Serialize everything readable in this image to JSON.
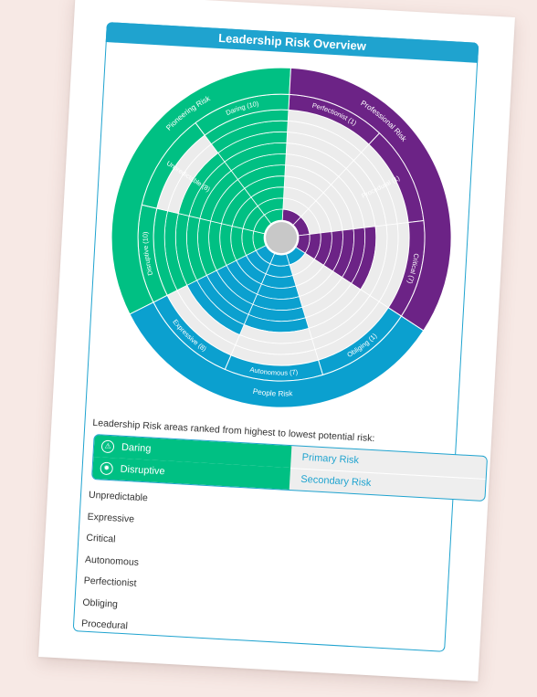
{
  "document": {
    "title": "Leadership Risk Overview"
  },
  "chart_data": {
    "type": "radial-bar",
    "max_value": 10,
    "groups": [
      {
        "name": "Pioneering Risk",
        "color": "#00c083",
        "scales": [
          "Daring",
          "Unpredictable",
          "Disruptive"
        ]
      },
      {
        "name": "Professional Risk",
        "color": "#6c2386",
        "scales": [
          "Perfectionist",
          "Procedural",
          "Critical"
        ]
      },
      {
        "name": "People Risk",
        "color": "#0ba0cf",
        "scales": [
          "Obliging",
          "Autonomous",
          "Expressive"
        ]
      }
    ],
    "segments": [
      {
        "scale": "Perfectionist",
        "label": "Perfectionist (1)",
        "value": 1,
        "group": "Professional Risk"
      },
      {
        "scale": "Procedural",
        "label": "Procedural (1)",
        "value": 1,
        "group": "Professional Risk"
      },
      {
        "scale": "Critical",
        "label": "Critical (7)",
        "value": 7,
        "group": "Professional Risk"
      },
      {
        "scale": "Obliging",
        "label": "Obliging (1)",
        "value": 1,
        "group": "People Risk"
      },
      {
        "scale": "Autonomous",
        "label": "Autonomous (7)",
        "value": 7,
        "group": "People Risk"
      },
      {
        "scale": "Expressive",
        "label": "Expressive (8)",
        "value": 8,
        "group": "People Risk"
      },
      {
        "scale": "Disruptive",
        "label": "Disruptive (10)",
        "value": 10,
        "group": "Pioneering Risk"
      },
      {
        "scale": "Unpredictable",
        "label": "Unpredictable (8)",
        "value": 8,
        "group": "Pioneering Risk"
      },
      {
        "scale": "Daring",
        "label": "Daring (10)",
        "value": 10,
        "group": "Pioneering Risk"
      }
    ],
    "empty_color": "#ececec",
    "center_color": "#c8c8c8"
  },
  "ranking": {
    "caption": "Leadership Risk areas ranked from highest to lowest potential risk:",
    "primary": {
      "name": "Daring",
      "tag": "Primary Risk",
      "icon": "warning-icon"
    },
    "secondary": {
      "name": "Disruptive",
      "tag": "Secondary Risk",
      "icon": "disruptive-icon"
    },
    "others": [
      "Unpredictable",
      "Expressive",
      "Critical",
      "Autonomous",
      "Perfectionist",
      "Obliging",
      "Procedural"
    ]
  }
}
